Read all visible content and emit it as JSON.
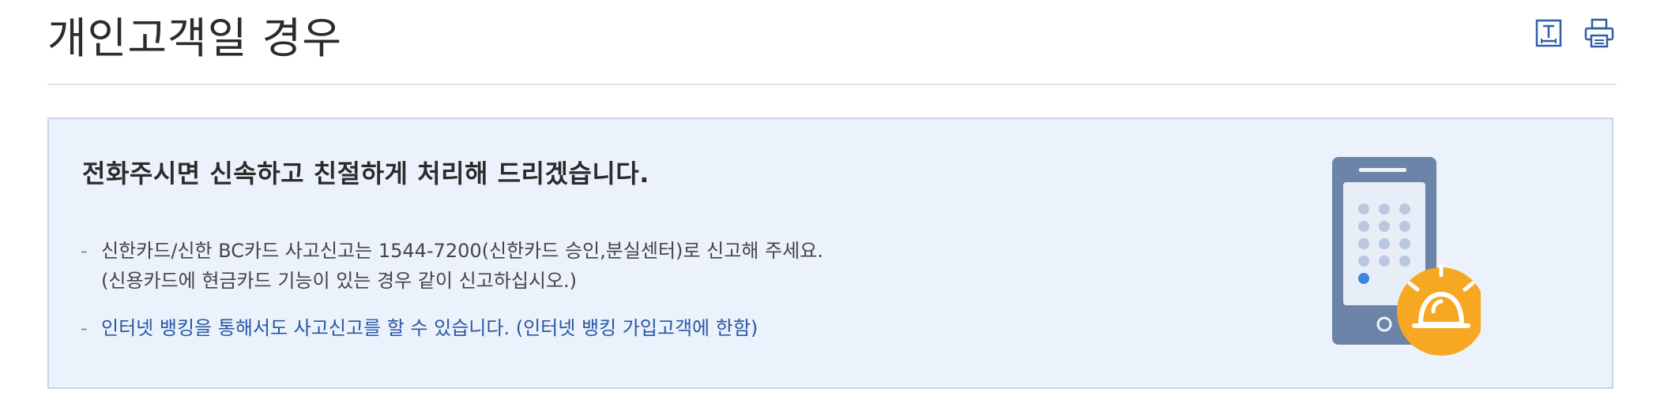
{
  "header": {
    "title": "개인고객일 경우",
    "tools": [
      {
        "name": "text-size-icon"
      },
      {
        "name": "print-icon"
      }
    ]
  },
  "info_box": {
    "heading": "전화주시면 신속하고 친절하게 처리해 드리겠습니다.",
    "items": [
      {
        "line1": "신한카드/신한 BC카드 사고신고는 1544-7200(신한카드 승인,분실센터)로 신고해 주세요.",
        "line2": "(신용카드에 현금카드 기능이 있는 경우 같이 신고하십시오.)"
      },
      {
        "line1": "인터넷 뱅킹을 통해서도 사고신고를 할 수 있습니다. (인터넷 뱅킹 가입고객에 한함)"
      }
    ],
    "dash": "-",
    "illustration": "phone-alarm-icon"
  },
  "colors": {
    "box_bg": "#ecf2fb",
    "box_border": "#c8d4e8",
    "link": "#2857a6",
    "phone": "#6b84a8",
    "alarm": "#f7a823"
  }
}
